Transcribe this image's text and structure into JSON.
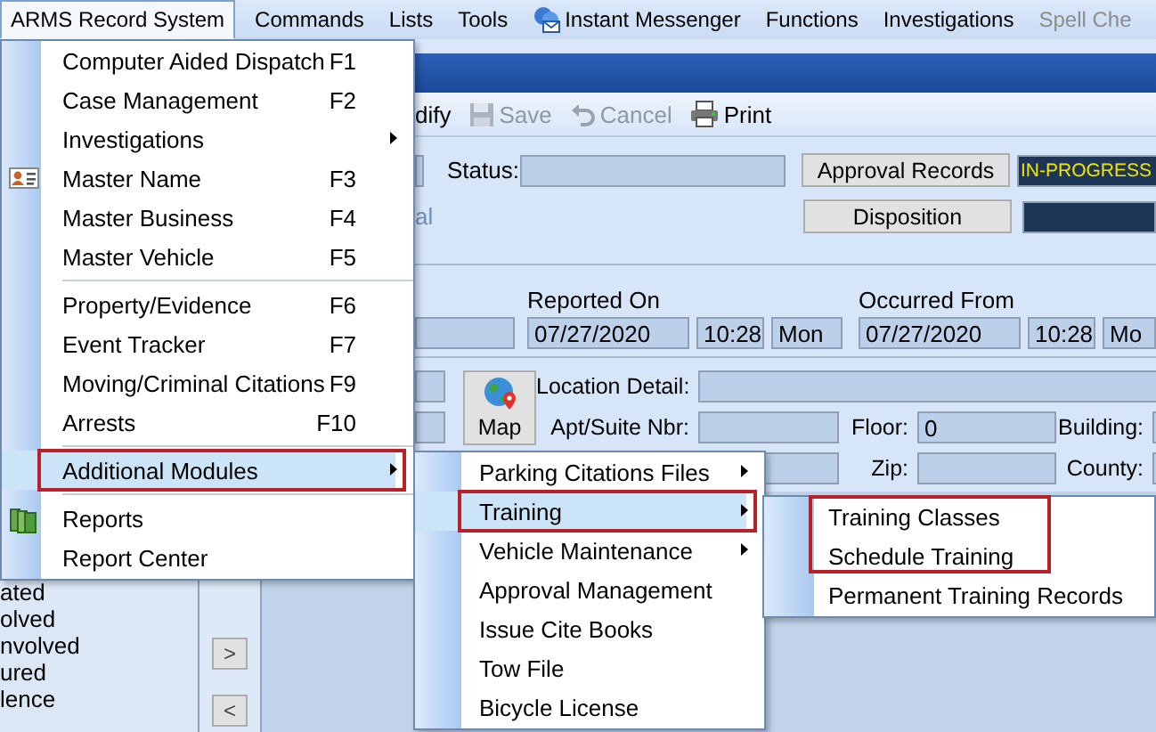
{
  "menu_bar": [
    {
      "label": "ARMS Record System",
      "kind": "text",
      "selected": true,
      "disabled": false
    },
    {
      "label": "Commands",
      "kind": "text",
      "selected": false,
      "disabled": false
    },
    {
      "label": "Lists",
      "kind": "text",
      "selected": false,
      "disabled": false
    },
    {
      "label": "Tools",
      "kind": "text",
      "selected": false,
      "disabled": false
    },
    {
      "label": "Instant Messenger",
      "kind": "messenger",
      "selected": false,
      "disabled": false
    },
    {
      "label": "Functions",
      "kind": "text",
      "selected": false,
      "disabled": false
    },
    {
      "label": "Investigations",
      "kind": "text",
      "selected": false,
      "disabled": false
    },
    {
      "label": "Spell Che",
      "kind": "text",
      "selected": false,
      "disabled": true
    }
  ],
  "toolbar": [
    {
      "label": "dify",
      "kind": "text",
      "disabled": false
    },
    {
      "label": "Save",
      "kind": "save",
      "disabled": true
    },
    {
      "label": "Cancel",
      "kind": "undo",
      "disabled": true
    },
    {
      "label": "Print",
      "kind": "print",
      "disabled": false
    }
  ],
  "record": {
    "status_label": "Status:",
    "approval_button": "Approval Records",
    "approval_status": "IN-PROGRESS",
    "disposition_button": "Disposition",
    "label_fragment": "al"
  },
  "dates": [
    {
      "label": "Reported On",
      "date": "07/27/2020",
      "time": "10:28",
      "day": "Mon"
    },
    {
      "label": "Occurred From",
      "date": "07/27/2020",
      "time": "10:28",
      "day": "Mo"
    }
  ],
  "location": {
    "map_button": "Map",
    "location_detail_label": "Location Detail:",
    "apt_label": "Apt/Suite Nbr:",
    "floor_label": "Floor:",
    "floor_value": "0",
    "building_label": "Building:",
    "zip_label": "Zip:",
    "county_label": "County:"
  },
  "side_list": [
    "ated",
    "olved",
    "nvolved",
    "ured",
    "lence"
  ],
  "move_buttons": [
    ">",
    "<"
  ],
  "menus": [
    {
      "items": [
        {
          "label": "Computer Aided Dispatch",
          "shortcut": "F1",
          "kind": "plain",
          "submenu": false,
          "separator_after": false,
          "selected": false,
          "outlined": false
        },
        {
          "label": "Case Management",
          "shortcut": "F2",
          "kind": "plain",
          "submenu": false,
          "separator_after": false,
          "selected": false,
          "outlined": false
        },
        {
          "label": "Investigations",
          "kind": "plain",
          "submenu": true,
          "separator_after": false,
          "selected": false,
          "outlined": false
        },
        {
          "label": "Master Name",
          "shortcut": "F3",
          "kind": "card",
          "submenu": false,
          "separator_after": false,
          "selected": false,
          "outlined": false
        },
        {
          "label": "Master Business",
          "shortcut": "F4",
          "kind": "plain",
          "submenu": false,
          "separator_after": false,
          "selected": false,
          "outlined": false
        },
        {
          "label": "Master Vehicle",
          "shortcut": "F5",
          "kind": "plain",
          "submenu": false,
          "separator_after": true,
          "selected": false,
          "outlined": false
        },
        {
          "label": "Property/Evidence",
          "shortcut": "F6",
          "kind": "plain",
          "submenu": false,
          "separator_after": false,
          "selected": false,
          "outlined": false
        },
        {
          "label": "Event Tracker",
          "shortcut": "F7",
          "kind": "plain",
          "submenu": false,
          "separator_after": false,
          "selected": false,
          "outlined": false
        },
        {
          "label": "Moving/Criminal Citations",
          "shortcut": "F9",
          "kind": "plain",
          "submenu": false,
          "separator_after": false,
          "selected": false,
          "outlined": false
        },
        {
          "label": "Arrests",
          "shortcut": "F10",
          "kind": "plain",
          "submenu": false,
          "separator_after": true,
          "selected": false,
          "outlined": false
        },
        {
          "label": "Additional Modules",
          "kind": "plain",
          "submenu": true,
          "separator_after": true,
          "selected": true,
          "outlined": true
        },
        {
          "label": "Reports",
          "kind": "books",
          "submenu": false,
          "separator_after": false,
          "selected": false,
          "outlined": false
        },
        {
          "label": "Report Center",
          "kind": "plain",
          "submenu": false,
          "separator_after": false,
          "selected": false,
          "outlined": false
        }
      ]
    },
    {
      "items": [
        {
          "label": "Parking Citations Files",
          "kind": "plain",
          "submenu": true,
          "separator_after": false,
          "selected": false,
          "outlined": false
        },
        {
          "label": "Training",
          "kind": "plain",
          "submenu": true,
          "separator_after": false,
          "selected": true,
          "outlined": true
        },
        {
          "label": "Vehicle Maintenance",
          "kind": "plain",
          "submenu": true,
          "separator_after": false,
          "selected": false,
          "outlined": false
        },
        {
          "label": "Approval Management",
          "kind": "plain",
          "submenu": false,
          "separator_after": false,
          "selected": false,
          "outlined": false
        },
        {
          "label": "Issue Cite Books",
          "kind": "plain",
          "submenu": false,
          "separator_after": false,
          "selected": false,
          "outlined": false
        },
        {
          "label": "Tow File",
          "kind": "plain",
          "submenu": false,
          "separator_after": false,
          "selected": false,
          "outlined": false
        },
        {
          "label": "Bicycle License",
          "kind": "plain",
          "submenu": false,
          "separator_after": false,
          "selected": false,
          "outlined": false
        }
      ]
    },
    {
      "items": [
        {
          "label": "Training Classes",
          "kind": "plain",
          "submenu": false,
          "separator_after": false,
          "selected": false,
          "outlined": true
        },
        {
          "label": "Schedule Training",
          "kind": "plain",
          "submenu": false,
          "separator_after": false,
          "selected": false,
          "outlined": true
        },
        {
          "label": "Permanent Training Records",
          "kind": "plain",
          "submenu": false,
          "separator_after": false,
          "selected": false,
          "outlined": false
        }
      ]
    }
  ]
}
